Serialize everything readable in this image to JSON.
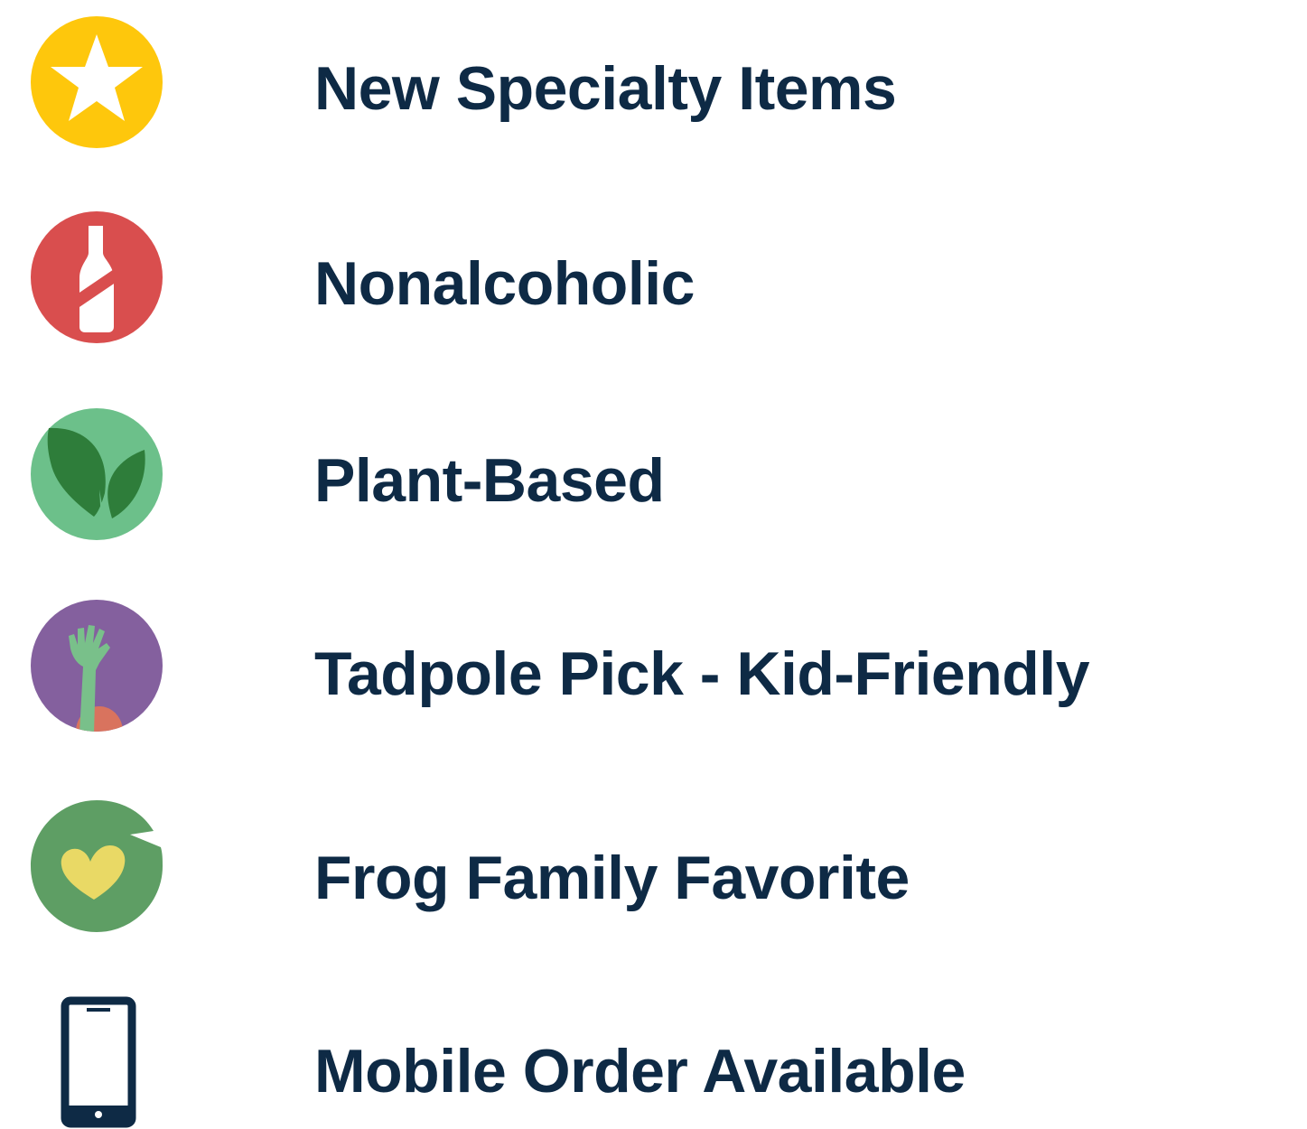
{
  "legend": {
    "items": [
      {
        "label": "New Specialty Items",
        "icon": "star-icon",
        "color": "#fec70c"
      },
      {
        "label": "Nonalcoholic",
        "icon": "crossed-bottle-icon",
        "color": "#d94e4e"
      },
      {
        "label": "Plant-Based",
        "icon": "leaves-icon",
        "color": "#6cc08a"
      },
      {
        "label": "Tadpole Pick - Kid-Friendly",
        "icon": "raised-hand-icon",
        "color": "#84609e"
      },
      {
        "label": "Frog Family Favorite",
        "icon": "lily-pad-heart-icon",
        "color": "#5e9e64"
      },
      {
        "label": "Mobile Order Available",
        "icon": "mobile-phone-icon",
        "color": "#0e2a45"
      }
    ],
    "text_color": "#0e2a45"
  }
}
